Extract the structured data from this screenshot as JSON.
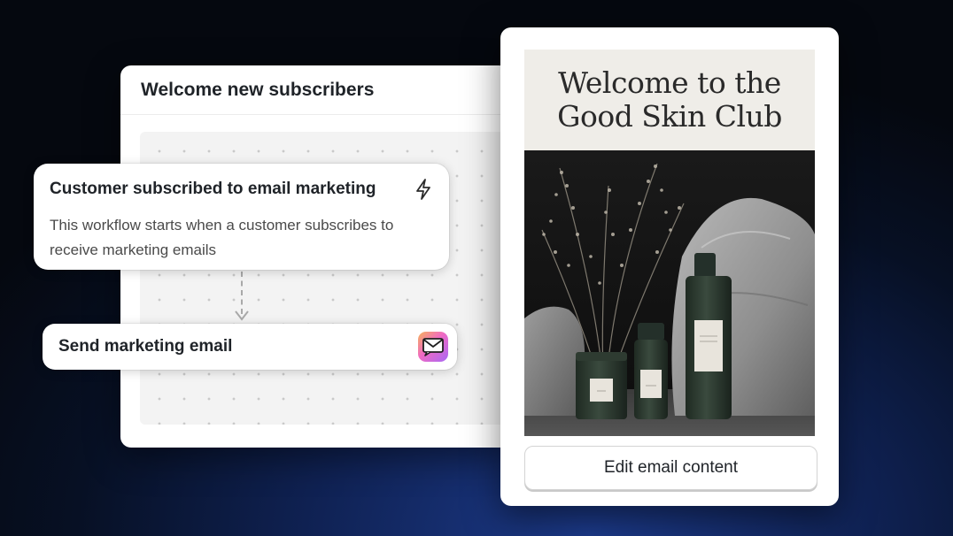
{
  "workflow": {
    "title": "Welcome new subscribers",
    "trigger": {
      "title": "Customer subscribed to email marketing",
      "description": "This workflow starts when a customer subscribes to receive marketing emails",
      "icon": "bolt-icon"
    },
    "action": {
      "label": "Send marketing email",
      "icon": "mail-app-icon"
    }
  },
  "email_preview": {
    "headline_line1": "Welcome to the",
    "headline_line2": "Good Skin Club",
    "image": "skincare-products-photo",
    "edit_button_label": "Edit email content"
  },
  "colors": {
    "background": "#0f2152",
    "panel": "#ffffff",
    "header_bg": "#efede8",
    "bottle": "#2c3a2e"
  }
}
